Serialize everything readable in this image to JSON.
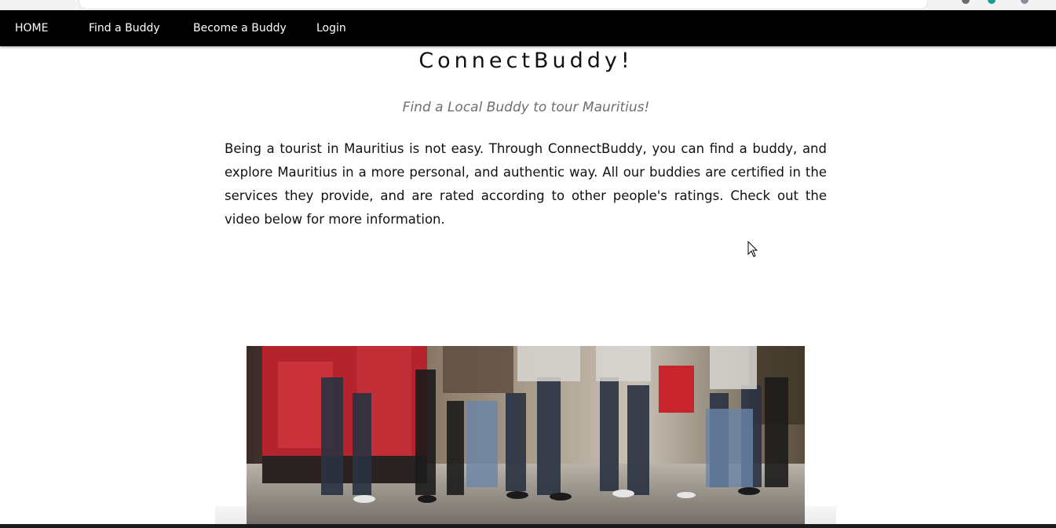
{
  "nav": {
    "items": [
      {
        "label": "HOME"
      },
      {
        "label": "Find a Buddy"
      },
      {
        "label": "Become a Buddy"
      },
      {
        "label": "Login"
      }
    ]
  },
  "hero": {
    "title": "ConnectBuddy!",
    "tagline": "Find a Local Buddy to tour Mauritius!",
    "description": "Being a tourist in Mauritius is not easy. Through ConnectBuddy, you can find a buddy, and explore Mauritius in a more personal, and authentic way. All our buddies are certified in the services they provide, and are rated according to other people's ratings. Check out the video below for more information."
  },
  "video": {
    "icon": "video-frame"
  },
  "colors": {
    "nav_background": "#000000",
    "nav_text": "#ffffff",
    "title_text": "#111111",
    "tagline_text": "#6e6e6e",
    "body_text": "#111111",
    "page_background": "#ffffff"
  }
}
